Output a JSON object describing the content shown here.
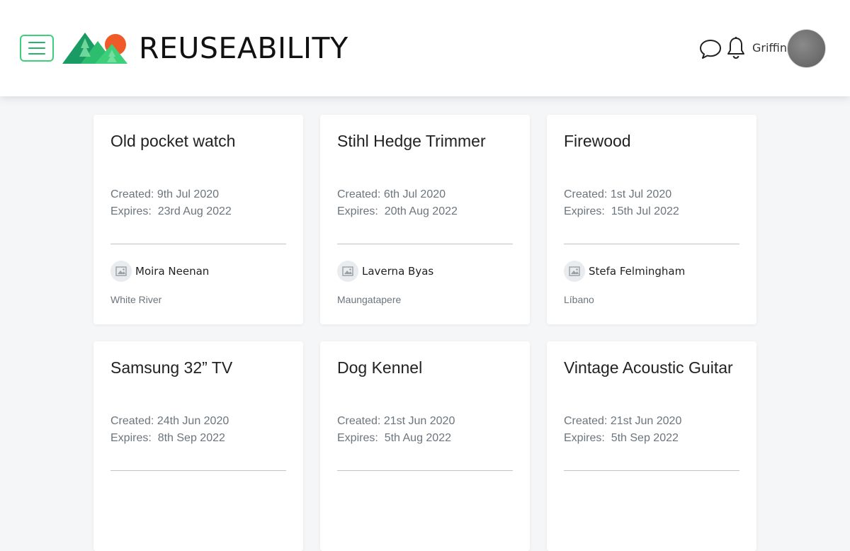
{
  "header": {
    "brand": "REUSEABILITY",
    "username": "Griffin",
    "icons": [
      "menu-icon",
      "logo-mountains-icon",
      "chat-bubble-icon",
      "bell-icon",
      "user-avatar"
    ],
    "colors": {
      "accent": "#3ecf7a",
      "brand_dark_green": "#1a9b63",
      "sun": "#f05a28"
    }
  },
  "listings": [
    {
      "title": "Old pocket watch",
      "created_label": "Created:",
      "created": "9th Jul 2020",
      "expires_label": "Expires:",
      "expires": "23rd Aug 2022",
      "seller": "Moira Neenan",
      "location": "White River"
    },
    {
      "title": "Stihl Hedge Trimmer",
      "created_label": "Created:",
      "created": "6th Jul 2020",
      "expires_label": "Expires:",
      "expires": "20th Aug 2022",
      "seller": "Laverna Byas",
      "location": "Maungatapere"
    },
    {
      "title": "Firewood",
      "created_label": "Created:",
      "created": "1st Jul 2020",
      "expires_label": "Expires:",
      "expires": "15th Jul 2022",
      "seller": "Stefa Felmingham",
      "location": "Líbano"
    },
    {
      "title": "Samsung 32” TV",
      "created_label": "Created:",
      "created": "24th Jun 2020",
      "expires_label": "Expires:",
      "expires": "8th Sep 2022",
      "seller": "",
      "location": ""
    },
    {
      "title": "Dog Kennel",
      "created_label": "Created:",
      "created": "21st Jun 2020",
      "expires_label": "Expires:",
      "expires": "5th Aug 2022",
      "seller": "",
      "location": ""
    },
    {
      "title": "Vintage Acoustic Guitar",
      "created_label": "Created:",
      "created": "21st Jun 2020",
      "expires_label": "Expires:",
      "expires": "5th Sep 2022",
      "seller": "",
      "location": ""
    }
  ]
}
